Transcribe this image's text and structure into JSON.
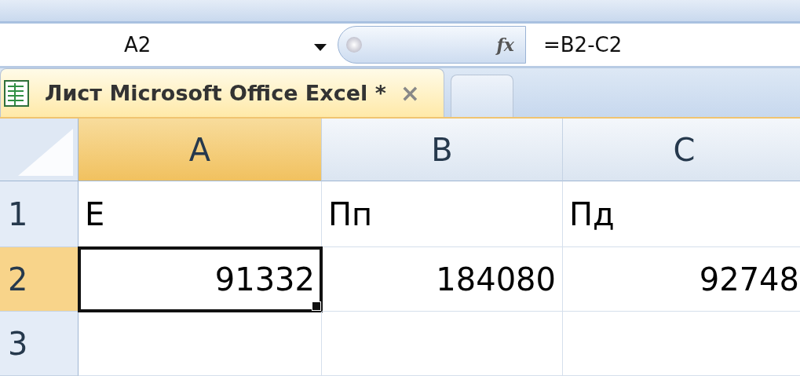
{
  "formula_bar": {
    "name_box": "A2",
    "function_label": "fx",
    "formula": "=B2-C2"
  },
  "tabs": [
    {
      "label": "Лист Microsoft Office Excel *",
      "close": "×",
      "selected": true
    },
    {
      "selected": false
    }
  ],
  "sheet": {
    "columns": [
      {
        "label": "A",
        "selected": true
      },
      {
        "label": "B",
        "selected": false
      },
      {
        "label": "C",
        "selected": false
      }
    ],
    "rows": [
      {
        "label": "1",
        "selected": false,
        "cells": [
          {
            "value": "Е",
            "selected": false,
            "kind": "text"
          },
          {
            "value": "Пп",
            "selected": false,
            "kind": "text"
          },
          {
            "value": "Пд",
            "selected": false,
            "kind": "text"
          }
        ]
      },
      {
        "label": "2",
        "selected": true,
        "cells": [
          {
            "value": "91332",
            "selected": true,
            "kind": "number"
          },
          {
            "value": "184080",
            "selected": false,
            "kind": "number"
          },
          {
            "value": "92748",
            "selected": false,
            "kind": "number"
          }
        ]
      },
      {
        "label": "3",
        "selected": false
      }
    ]
  }
}
